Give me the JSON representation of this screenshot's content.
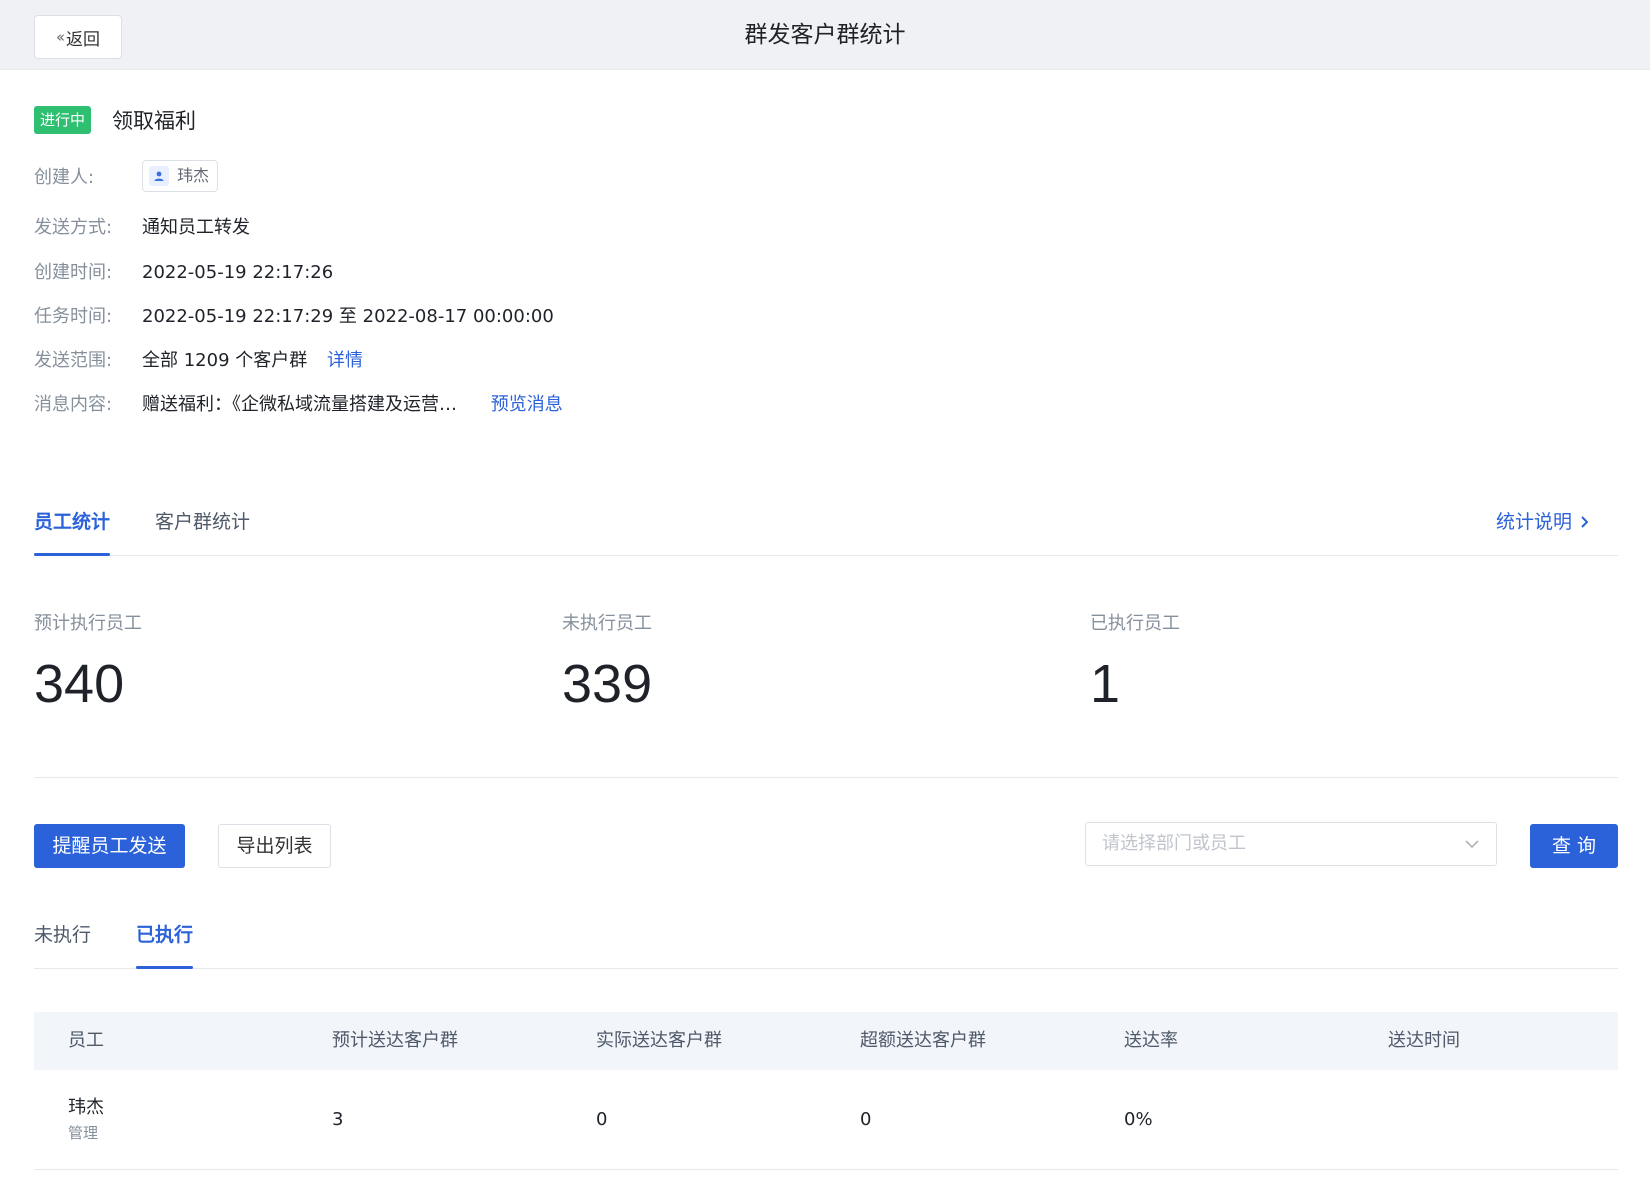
{
  "header": {
    "back_label": "返回",
    "title": "群发客户群统计"
  },
  "task": {
    "status": "进行中",
    "status_color": "#2fbf71",
    "name": "领取福利"
  },
  "info": {
    "creator_label": "创建人:",
    "creator_name": "玮杰",
    "send_method_label": "发送方式:",
    "send_method": "通知员工转发",
    "created_time_label": "创建时间:",
    "created_time": "2022-05-19 22:17:26",
    "task_time_label": "任务时间:",
    "task_time": "2022-05-19 22:17:29 至 2022-08-17 00:00:00",
    "scope_label": "发送范围:",
    "scope": "全部 1209 个客户群",
    "scope_link": "详情",
    "content_label": "消息内容:",
    "content": "赠送福利：《企微私域流量搭建及运营…",
    "content_link": "预览消息"
  },
  "main_tabs": [
    {
      "label": "员工统计",
      "active": true
    },
    {
      "label": "客户群统计",
      "active": false
    }
  ],
  "stats_help": "统计说明",
  "stats": [
    {
      "label": "预计执行员工",
      "value": "340"
    },
    {
      "label": "未执行员工",
      "value": "339"
    },
    {
      "label": "已执行员工",
      "value": "1"
    }
  ],
  "actions": {
    "remind_label": "提醒员工发送",
    "export_label": "导出列表",
    "select_placeholder": "请选择部门或员工",
    "query_label": "查 询"
  },
  "sub_tabs": [
    {
      "label": "未执行",
      "active": false
    },
    {
      "label": "已执行",
      "active": true
    }
  ],
  "table": {
    "columns": [
      "员工",
      "预计送达客户群",
      "实际送达客户群",
      "超额送达客户群",
      "送达率",
      "送达时间"
    ],
    "rows": [
      {
        "name": "玮杰",
        "dept": "管理",
        "expected": "3",
        "actual": "0",
        "extra": "0",
        "rate": "0%",
        "time": ""
      }
    ]
  },
  "colors": {
    "accent": "#2b62d9",
    "muted_text": "#86909c",
    "header_bg": "#f0f1f4"
  }
}
